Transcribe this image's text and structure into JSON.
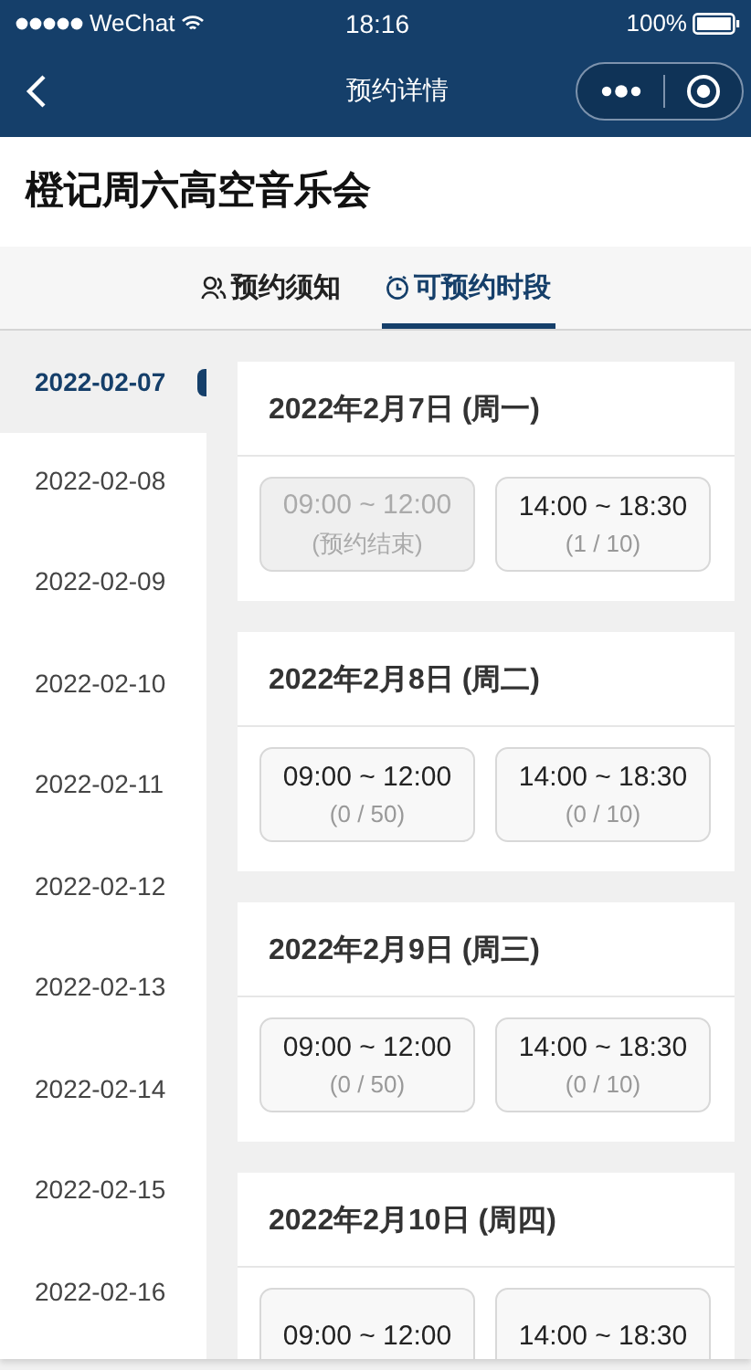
{
  "status_bar": {
    "carrier": "WeChat",
    "time": "18:16",
    "battery": "100%"
  },
  "nav": {
    "title": "预约详情"
  },
  "event_title": "橙记周六高空音乐会",
  "tabs": [
    {
      "label": "预约须知",
      "kind": "person",
      "selected": false
    },
    {
      "label": "可预约时段",
      "kind": "clock",
      "selected": true
    }
  ],
  "dates": [
    {
      "label": "2022-02-07",
      "selected": true
    },
    {
      "label": "2022-02-08",
      "selected": false
    },
    {
      "label": "2022-02-09",
      "selected": false
    },
    {
      "label": "2022-02-10",
      "selected": false
    },
    {
      "label": "2022-02-11",
      "selected": false
    },
    {
      "label": "2022-02-12",
      "selected": false
    },
    {
      "label": "2022-02-13",
      "selected": false
    },
    {
      "label": "2022-02-14",
      "selected": false
    },
    {
      "label": "2022-02-15",
      "selected": false
    },
    {
      "label": "2022-02-16",
      "selected": false
    }
  ],
  "days": [
    {
      "heading": "2022年2月7日 (周一)",
      "slots": [
        {
          "time": "09:00 ~ 12:00",
          "count": "(预约结束)",
          "disabled": true
        },
        {
          "time": "14:00 ~ 18:30",
          "count": "(1 / 10)",
          "disabled": false
        }
      ]
    },
    {
      "heading": "2022年2月8日 (周二)",
      "slots": [
        {
          "time": "09:00 ~ 12:00",
          "count": "(0 / 50)",
          "disabled": false
        },
        {
          "time": "14:00 ~ 18:30",
          "count": "(0 / 10)",
          "disabled": false
        }
      ]
    },
    {
      "heading": "2022年2月9日 (周三)",
      "slots": [
        {
          "time": "09:00 ~ 12:00",
          "count": "(0 / 50)",
          "disabled": false
        },
        {
          "time": "14:00 ~ 18:30",
          "count": "(0 / 10)",
          "disabled": false
        }
      ]
    },
    {
      "heading": "2022年2月10日 (周四)",
      "slots": [
        {
          "time": "09:00 ~ 12:00",
          "disabled": false
        },
        {
          "time": "14:00 ~ 18:30",
          "disabled": false
        }
      ]
    }
  ]
}
